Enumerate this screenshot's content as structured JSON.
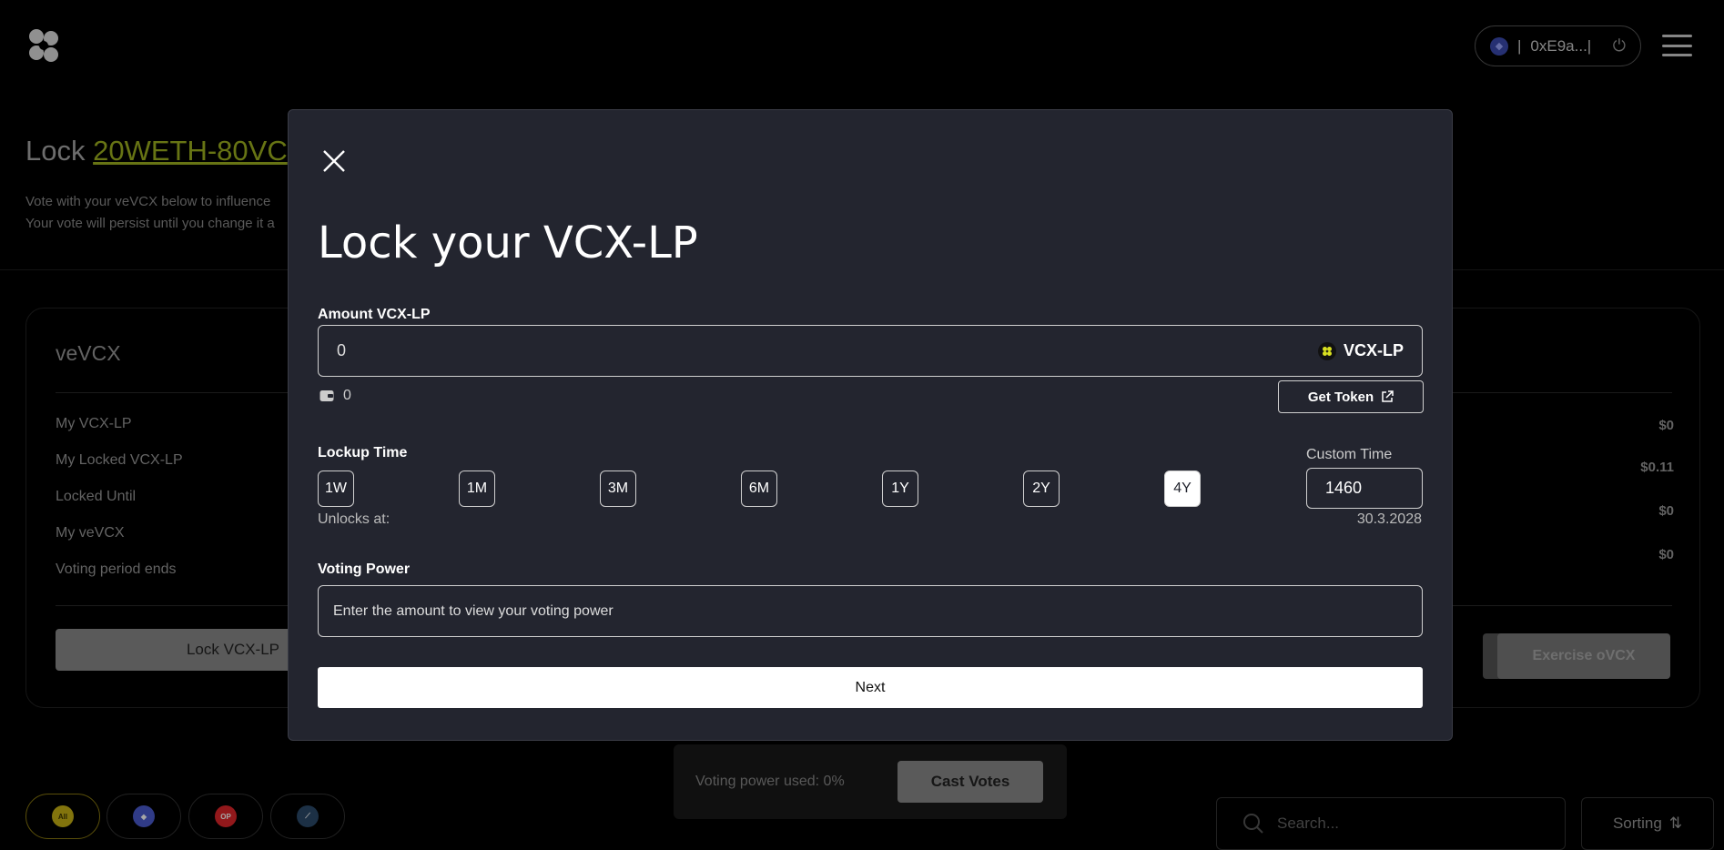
{
  "header": {
    "wallet_separator": "|",
    "wallet_address": "0xE9a...|",
    "chain_icon": "ethereum-icon",
    "power_icon": "power-icon",
    "menu_icon": "hamburger-icon"
  },
  "background": {
    "title_prefix": "Lock ",
    "title_link": "20WETH-80VC",
    "subtitle_line1": "Vote with your veVCX below to influence",
    "subtitle_line2": "Your vote will persist until you change it a",
    "card": {
      "title": "veVCX",
      "rows": [
        {
          "label": "My VCX-LP",
          "value": "$0"
        },
        {
          "label": "My Locked VCX-LP",
          "value": "$0.11"
        },
        {
          "label": "Locked Until",
          "value": "$0"
        },
        {
          "label": "My veVCX",
          "value": "$0"
        },
        {
          "label": "Voting period ends",
          "value": ""
        }
      ],
      "lock_button": "Lock VCX-LP",
      "exercise_button": "Exercise oVCX"
    },
    "vote_bar": {
      "used_label": "Voting power used: 0%",
      "cast_button": "Cast Votes"
    },
    "chain_filters": [
      {
        "label": "All",
        "color": "#c8b214",
        "text_color": "#3a3300"
      },
      {
        "label": "",
        "color": "#4a5bd0",
        "text_color": "#fff"
      },
      {
        "label": "OP",
        "color": "#e0262a",
        "text_color": "#fff"
      },
      {
        "label": "",
        "color": "#2b4a6a",
        "text_color": "#fff"
      }
    ],
    "search_placeholder": "Search...",
    "sorting_label": "Sorting"
  },
  "modal": {
    "title": "Lock your VCX-LP",
    "amount_label": "Amount VCX-LP",
    "amount_value": "0",
    "token_symbol": "VCX-LP",
    "balance_value": "0",
    "get_token_label": "Get Token",
    "lockup_label": "Lockup Time",
    "lockup_options": [
      "1W",
      "1M",
      "3M",
      "6M",
      "1Y",
      "2Y",
      "4Y"
    ],
    "lockup_selected": "4Y",
    "custom_time_label": "Custom Time",
    "custom_time_value": "1460",
    "unlocks_label": "Unlocks at:",
    "unlock_date": "30.3.2028",
    "voting_power_label": "Voting Power",
    "voting_power_placeholder": "Enter the amount to view your voting power",
    "next_label": "Next"
  }
}
